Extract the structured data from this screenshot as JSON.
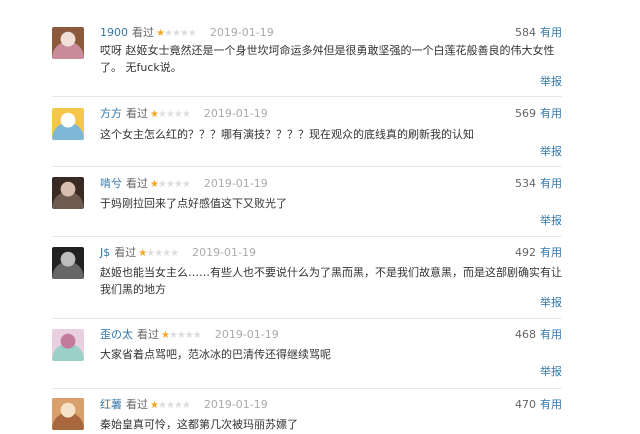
{
  "comments": [
    {
      "user": "1900",
      "status": "看过",
      "rating": 1,
      "date": "2019-01-19",
      "votes": "584",
      "useful": "有用",
      "text": "哎呀 赵姬女士竟然还是一个身世坎坷命运多舛但是很勇敢坚强的一个白莲花般善良的伟大女性了。 无fuck说。",
      "report": "举报",
      "avatar_colors": [
        "#8b5a3c",
        "#f0e0d8",
        "#c98a9a"
      ]
    },
    {
      "user": "方方",
      "status": "看过",
      "rating": 1,
      "date": "2019-01-19",
      "votes": "569",
      "useful": "有用",
      "text": "这个女主怎么红的？？？哪有演技？？？？现在观众的底线真的刷新我的认知",
      "report": "举报",
      "avatar_colors": [
        "#f4c64a",
        "#ffffff",
        "#7fb7d9"
      ]
    },
    {
      "user": "啃兮",
      "status": "看过",
      "rating": 1,
      "date": "2019-01-19",
      "votes": "534",
      "useful": "有用",
      "text": "于妈刚拉回来了点好感值这下又败光了",
      "report": "举报",
      "avatar_colors": [
        "#3a2a24",
        "#d8bfae",
        "#6d5a50"
      ]
    },
    {
      "user": "J$",
      "status": "看过",
      "rating": 1,
      "date": "2019-01-19",
      "votes": "492",
      "useful": "有用",
      "text": "赵姬也能当女主么……有些人也不要说什么为了黑而黑，不是我们故意黑，而是这部剧确实有让我们黑的地方",
      "report": "举报",
      "avatar_colors": [
        "#222222",
        "#bdbdbd",
        "#666666"
      ]
    },
    {
      "user": "歪の太",
      "status": "看过",
      "rating": 1,
      "date": "2019-01-19",
      "votes": "468",
      "useful": "有用",
      "text": "大家省着点骂吧，范冰冰的巴清传还得继续骂呢",
      "report": "举报",
      "avatar_colors": [
        "#e8d0e0",
        "#c47a9a",
        "#9ad0c8"
      ]
    },
    {
      "user": "红薯",
      "status": "看过",
      "rating": 1,
      "date": "2019-01-19",
      "votes": "470",
      "useful": "有用",
      "text": "秦始皇真可怜，这都第几次被玛丽苏嫖了",
      "report": "",
      "avatar_colors": [
        "#d9a06b",
        "#f6e2c8",
        "#a8673c"
      ]
    }
  ]
}
